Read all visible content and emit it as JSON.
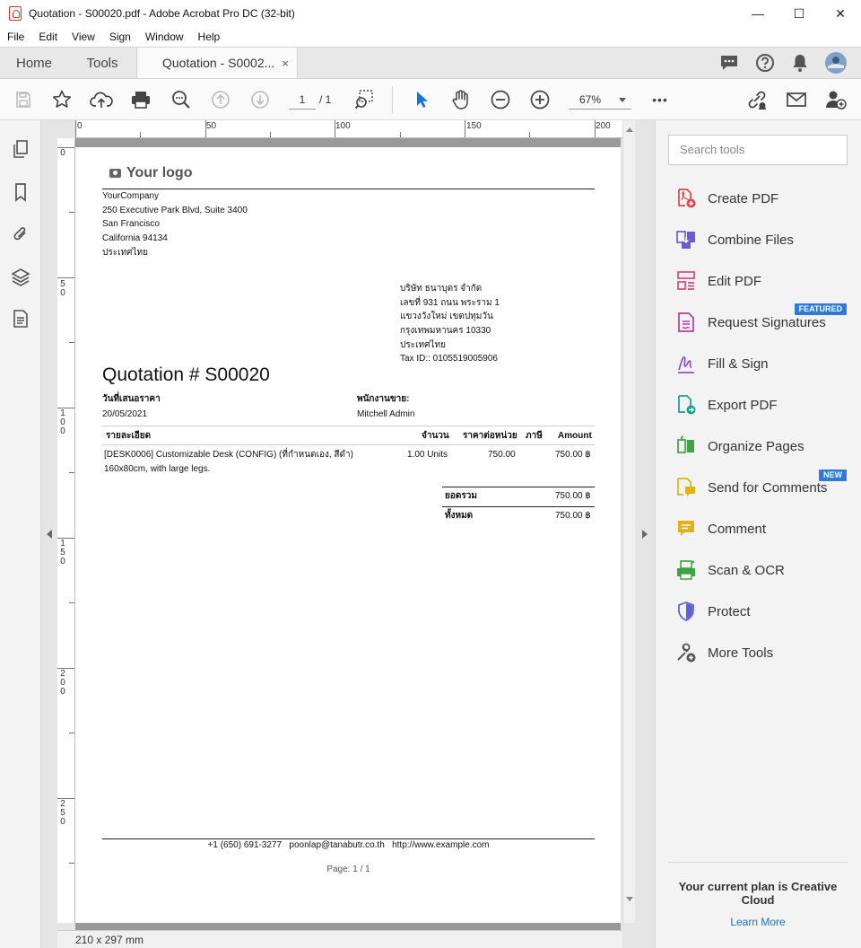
{
  "window": {
    "title": "Quotation - S00020.pdf - Adobe Acrobat Pro DC (32-bit)",
    "minimize": "—",
    "maximize": "☐",
    "close": "✕"
  },
  "menu": [
    "File",
    "Edit",
    "View",
    "Sign",
    "Window",
    "Help"
  ],
  "tabs": {
    "home": "Home",
    "tools": "Tools",
    "document": "Quotation - S0002...",
    "close": "×"
  },
  "toolbar": {
    "page_current": "1",
    "page_total": "/ 1",
    "zoom": "67%",
    "more": "•••"
  },
  "ruler": {
    "top_labels": [
      "0",
      "50",
      "100",
      "150",
      "200"
    ],
    "left_labels": [
      "0",
      "50",
      "100",
      "150",
      "200",
      "250"
    ]
  },
  "status": {
    "page_size": "210 x 297 mm"
  },
  "document": {
    "logo_text": "Your logo",
    "company_lines": [
      "YourCompany",
      "250 Executive Park Blvd, Suite 3400",
      "San Francisco",
      "California 94134",
      "ประเทศไทย"
    ],
    "customer_lines": [
      "บริษัท ธนาบุตร จำกัด",
      "เลขที่ 931 ถนน พระราม 1",
      "แขวงวังใหม่ เขตปทุมวัน",
      "กรุงเทพมหานคร 10330",
      "ประเทศไทย",
      "Tax ID:: 0105519005906"
    ],
    "title": "Quotation # S00020",
    "date_label": "วันที่เสนอราคา",
    "date_value": "20/05/2021",
    "salesperson_label": "พนักงานขาย:",
    "salesperson_value": "Mitchell Admin",
    "columns": [
      "รายละเอียด",
      "จำนวน",
      "ราคาต่อหน่วย",
      "ภาษี",
      "Amount"
    ],
    "line": {
      "description_1": "[DESK0006] Customizable Desk (CONFIG) (ที่กำหนดเอง, สีดำ)",
      "description_2": "160x80cm, with large legs.",
      "quantity": "1.00 Units",
      "unit_price": "750.00",
      "tax": "",
      "amount": "750.00 ฿"
    },
    "subtotal_label": "ยอดรวม",
    "subtotal_value": "750.00 ฿",
    "total_label": "ทั้งหมด",
    "total_value": "750.00 ฿",
    "footer": "+1 (650) 691-3277   poonlap@tanabutr.co.th   http://www.example.com",
    "page_number": "Page: 1 / 1"
  },
  "tools_panel": {
    "search_placeholder": "Search tools",
    "items": [
      {
        "label": "Create PDF",
        "icon": "create-pdf-icon",
        "color": "#e0464b"
      },
      {
        "label": "Combine Files",
        "icon": "combine-files-icon",
        "color": "#6d5bd0"
      },
      {
        "label": "Edit PDF",
        "icon": "edit-pdf-icon",
        "color": "#d9467f"
      },
      {
        "label": "Request Signatures",
        "icon": "request-signatures-icon",
        "color": "#b23ba6",
        "badge": "FEATURED"
      },
      {
        "label": "Fill & Sign",
        "icon": "fill-sign-icon",
        "color": "#8a4fd6"
      },
      {
        "label": "Export PDF",
        "icon": "export-pdf-icon",
        "color": "#18a08a"
      },
      {
        "label": "Organize Pages",
        "icon": "organize-pages-icon",
        "color": "#3ea345"
      },
      {
        "label": "Send for Comments",
        "icon": "send-for-comments-icon",
        "color": "#e0b21a",
        "badge": "NEW"
      },
      {
        "label": "Comment",
        "icon": "comment-icon",
        "color": "#e0b21a"
      },
      {
        "label": "Scan & OCR",
        "icon": "scan-ocr-icon",
        "color": "#3ea345"
      },
      {
        "label": "Protect",
        "icon": "protect-icon",
        "color": "#5a5fd6"
      },
      {
        "label": "More Tools",
        "icon": "more-tools-icon",
        "color": "#555555"
      }
    ],
    "plan_text": "Your current plan is Creative Cloud",
    "learn_more": "Learn More"
  },
  "colors": {
    "accent_blue": "#2d7bd6",
    "select_tool_blue": "#1473e6"
  }
}
